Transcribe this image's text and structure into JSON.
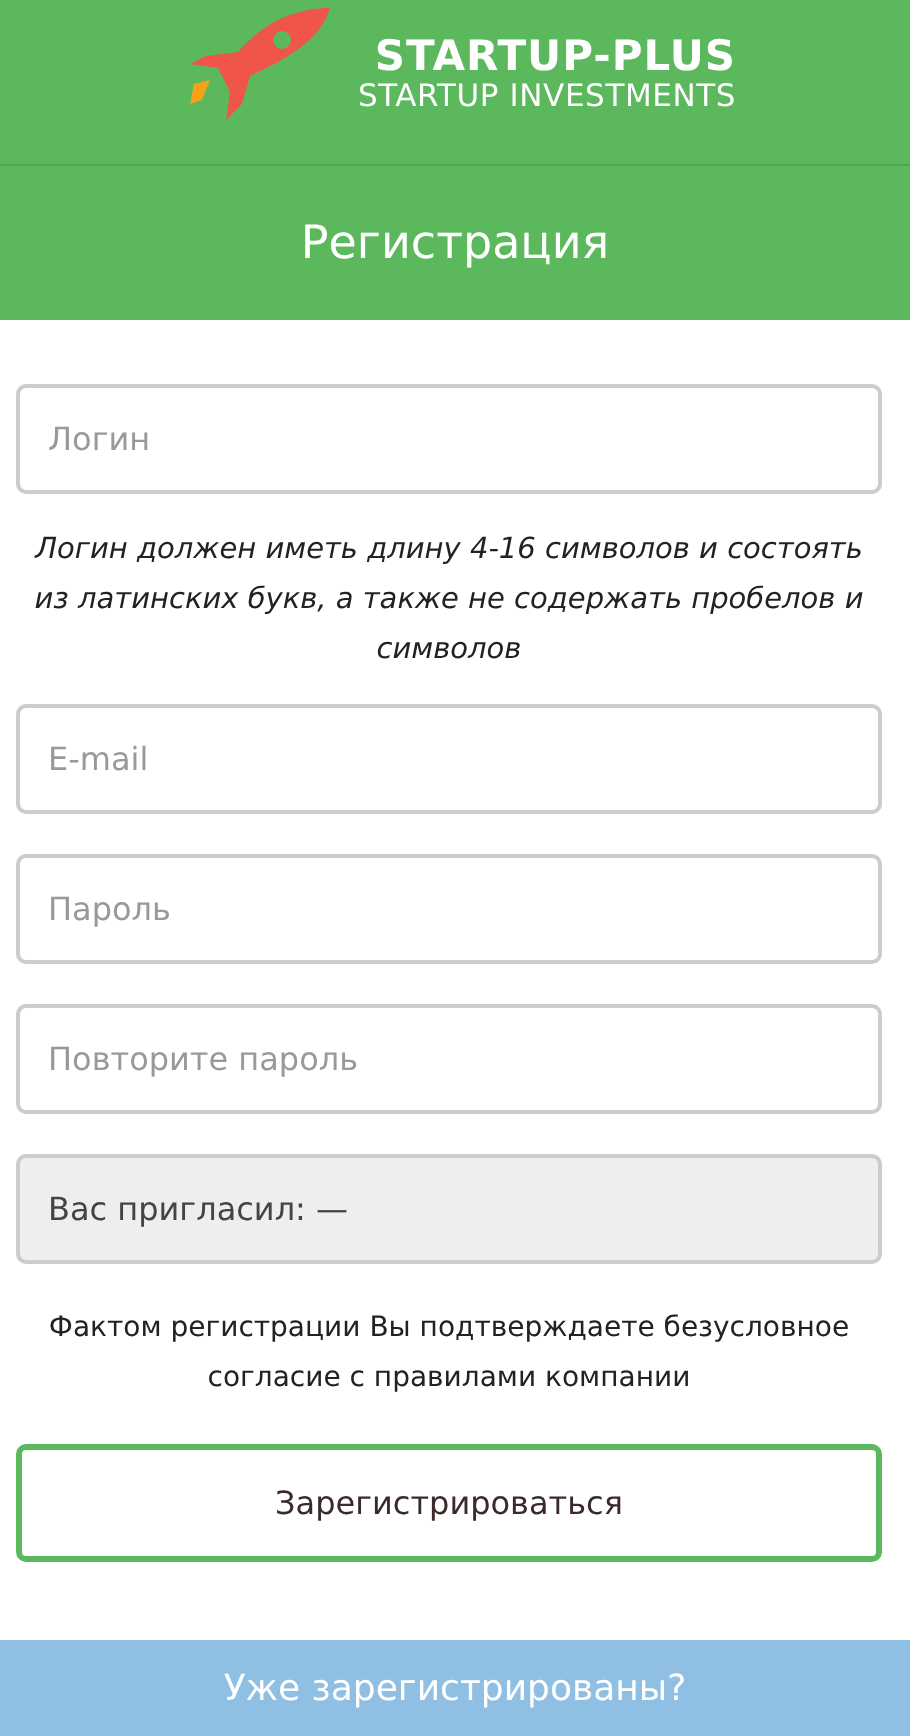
{
  "logo": {
    "title": "STARTUP-PLUS",
    "subtitle": "STARTUP INVESTMENTS"
  },
  "heading": "Регистрация",
  "login_field": {
    "placeholder": "Логин"
  },
  "login_hint": "Логин должен иметь длину 4-16 символов и состоять из латинских букв, а также не содержать пробелов и символов",
  "fields": [
    {
      "placeholder": "E-mail",
      "disabled": false
    },
    {
      "placeholder": "Пароль",
      "disabled": false
    },
    {
      "placeholder": "Повторите пароль",
      "disabled": false
    },
    {
      "value": "Вас пригласил: —",
      "disabled": true
    }
  ],
  "terms": "Фактом регистрации Вы подтверждаете безусловное согласие с правилами компании",
  "submit_button": "Зарегистрироваться",
  "login_link": "Уже зарегистрированы?"
}
